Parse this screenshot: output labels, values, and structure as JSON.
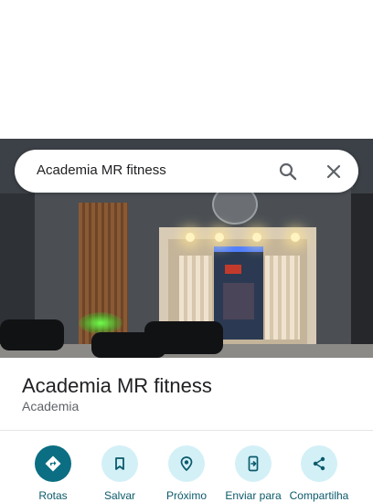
{
  "search": {
    "query": "Academia MR fitness"
  },
  "place": {
    "name": "Academia MR fitness",
    "category": "Academia"
  },
  "actions": [
    {
      "label": "Rotas",
      "icon": "directions-icon"
    },
    {
      "label": "Salvar",
      "icon": "bookmark-icon"
    },
    {
      "label": "Próximo",
      "icon": "nearby-icon"
    },
    {
      "label": "Enviar para",
      "icon": "send-to-phone-icon"
    },
    {
      "label": "Compartilha",
      "icon": "share-icon"
    }
  ],
  "colors": {
    "accent": "#0b6e82",
    "accent_light": "#d3f0f7",
    "label": "#0b5a6b"
  }
}
